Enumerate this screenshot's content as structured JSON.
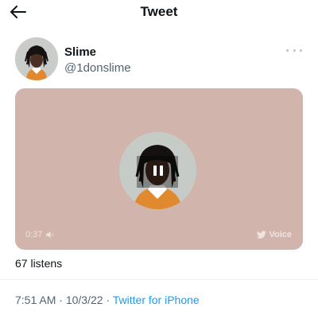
{
  "header": {
    "title": "Tweet",
    "back_icon": "arrow-left-icon"
  },
  "author": {
    "name": "Slime",
    "handle": "@1donslime",
    "more_icon": "more-dots-icon"
  },
  "voice": {
    "duration": "0:37",
    "label": "Voice",
    "state": "playing",
    "colors": {
      "card_bg": "#d1b4ab"
    }
  },
  "listens": "67 listens",
  "meta": {
    "time": "7:51 AM",
    "separator1": " · ",
    "date": "10/3/22",
    "separator2": " · ",
    "source": "Twitter for iPhone"
  },
  "colors": {
    "accent": "#1d9bf0",
    "text": "#0f1419",
    "muted": "#536471"
  }
}
